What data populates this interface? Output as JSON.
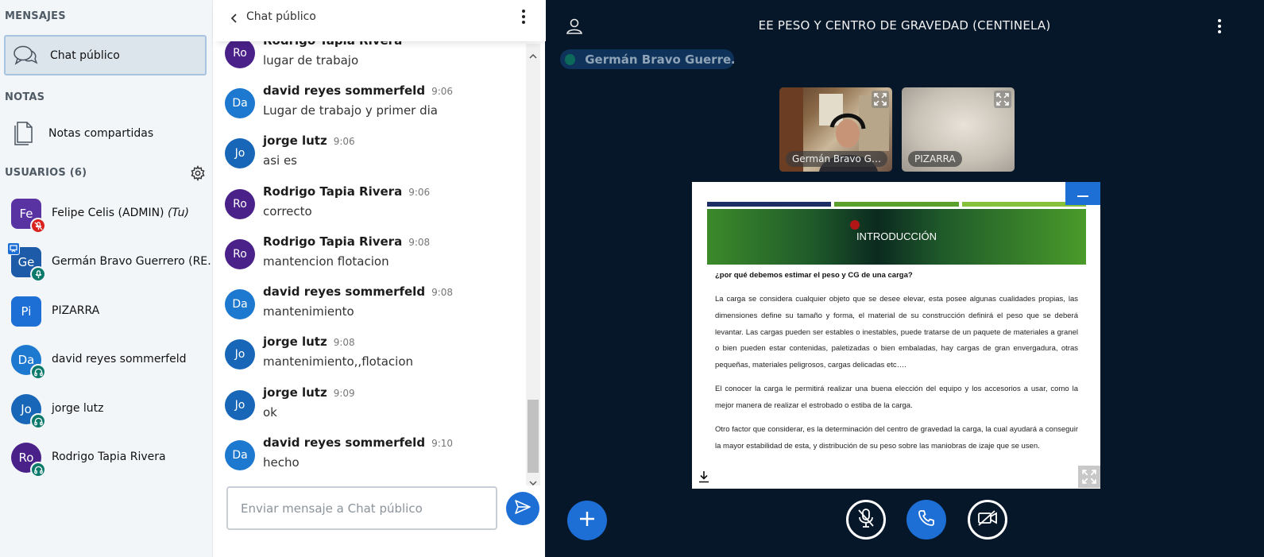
{
  "sidebar": {
    "messages_title": "MENSAJES",
    "public_chat_label": "Chat público",
    "notes_title": "NOTAS",
    "shared_notes_label": "Notas compartidas",
    "users_title": "USUARIOS (6)",
    "users": [
      {
        "initials": "Fe",
        "name": "Felipe Celis (ADMIN)",
        "suffix": "(Tu)",
        "color": "#5a33a3",
        "badge": "mic-muted",
        "badge_color": "#d9231f",
        "role": "moderator"
      },
      {
        "initials": "Ge",
        "name": "Germán Bravo Guerrero (RE…",
        "color": "#1d5ba8",
        "badge": "mic",
        "badge_color": "#0b7a6b",
        "role": "moderator",
        "presenter": true
      },
      {
        "initials": "Pi",
        "name": "PIZARRA",
        "color": "#1d6fd6",
        "badge": "none",
        "role": "moderator"
      },
      {
        "initials": "Da",
        "name": "david reyes sommerfeld",
        "color": "#1d78cf",
        "badge": "headphones",
        "badge_color": "#0b7a6b",
        "role": "viewer"
      },
      {
        "initials": "Jo",
        "name": "jorge lutz",
        "color": "#1866b8",
        "badge": "headphones",
        "badge_color": "#0b7a6b",
        "role": "viewer"
      },
      {
        "initials": "Ro",
        "name": "Rodrigo Tapia Rivera",
        "color": "#4a2188",
        "badge": "headphones",
        "badge_color": "#0b7a6b",
        "role": "viewer"
      }
    ]
  },
  "chat": {
    "title": "Chat público",
    "partial_top": {
      "initials": "Ro",
      "name": "Rodrigo Tapia Rivera",
      "text": "lugar de trabajo",
      "color": "#4a2188"
    },
    "messages": [
      {
        "initials": "Da",
        "name": "david reyes sommerfeld",
        "time": "9:06",
        "text": "Lugar de trabajo y primer dia",
        "color": "#1d78cf"
      },
      {
        "initials": "Jo",
        "name": "jorge lutz",
        "time": "9:06",
        "text": "asi es",
        "color": "#1866b8"
      },
      {
        "initials": "Ro",
        "name": "Rodrigo Tapia Rivera",
        "time": "9:06",
        "text": "correcto",
        "color": "#4a2188"
      },
      {
        "initials": "Ro",
        "name": "Rodrigo Tapia Rivera",
        "time": "9:08",
        "text": "mantencion flotacion",
        "color": "#4a2188"
      },
      {
        "initials": "Da",
        "name": "david reyes sommerfeld",
        "time": "9:08",
        "text": "mantenimiento",
        "color": "#1d78cf"
      },
      {
        "initials": "Jo",
        "name": "jorge lutz",
        "time": "9:08",
        "text": "mantenimiento,,flotacion",
        "color": "#1866b8"
      },
      {
        "initials": "Jo",
        "name": "jorge lutz",
        "time": "9:09",
        "text": "ok",
        "color": "#1866b8"
      },
      {
        "initials": "Da",
        "name": "david reyes sommerfeld",
        "time": "9:10",
        "text": "hecho",
        "color": "#1d78cf"
      }
    ],
    "input_placeholder": "Enviar mensaje a Chat público"
  },
  "main": {
    "meeting_title": "EE PESO Y CENTRO DE GRAVEDAD (CENTINELA)",
    "talking_indicator": "Germán Bravo Guerre…",
    "webcams": [
      {
        "label": "Germán Bravo G…"
      },
      {
        "label": "PIZARRA"
      }
    ],
    "slide": {
      "heading": "INTRODUCCIÓN",
      "question": "¿por qué debemos estimar el peso y CG de una carga?",
      "paragraphs": [
        "La carga se considera cualquier objeto que se desee elevar, esta posee algunas cualidades propias, las dimensiones define su tamaño y forma, el material de su construcción definirá el peso que se deberá levantar. Las cargas pueden ser estables o inestables, puede tratarse de un paquete de materiales a granel o bien pueden estar contenidas, paletizadas o bien embaladas, hay cargas de gran envergadura, otras pequeñas, materiales peligrosos, cargas delicadas etc….",
        "El conocer la carga le permitirá realizar una buena elección del equipo y los accesorios a usar, como la mejor manera de realizar el estrobado o estiba de la carga.",
        "Otro factor que considerar, es la determinación del centro de gravedad la carga, la cual ayudará a conseguir la mayor estabilidad de esta, y distribución de su peso sobre las maniobras de izaje que se usen."
      ]
    }
  },
  "colors": {
    "accent": "#1d6fd6",
    "main_bg": "#06172a",
    "sidebar_bg": "#f3f6f9",
    "talking_bg": "#0e3259"
  }
}
